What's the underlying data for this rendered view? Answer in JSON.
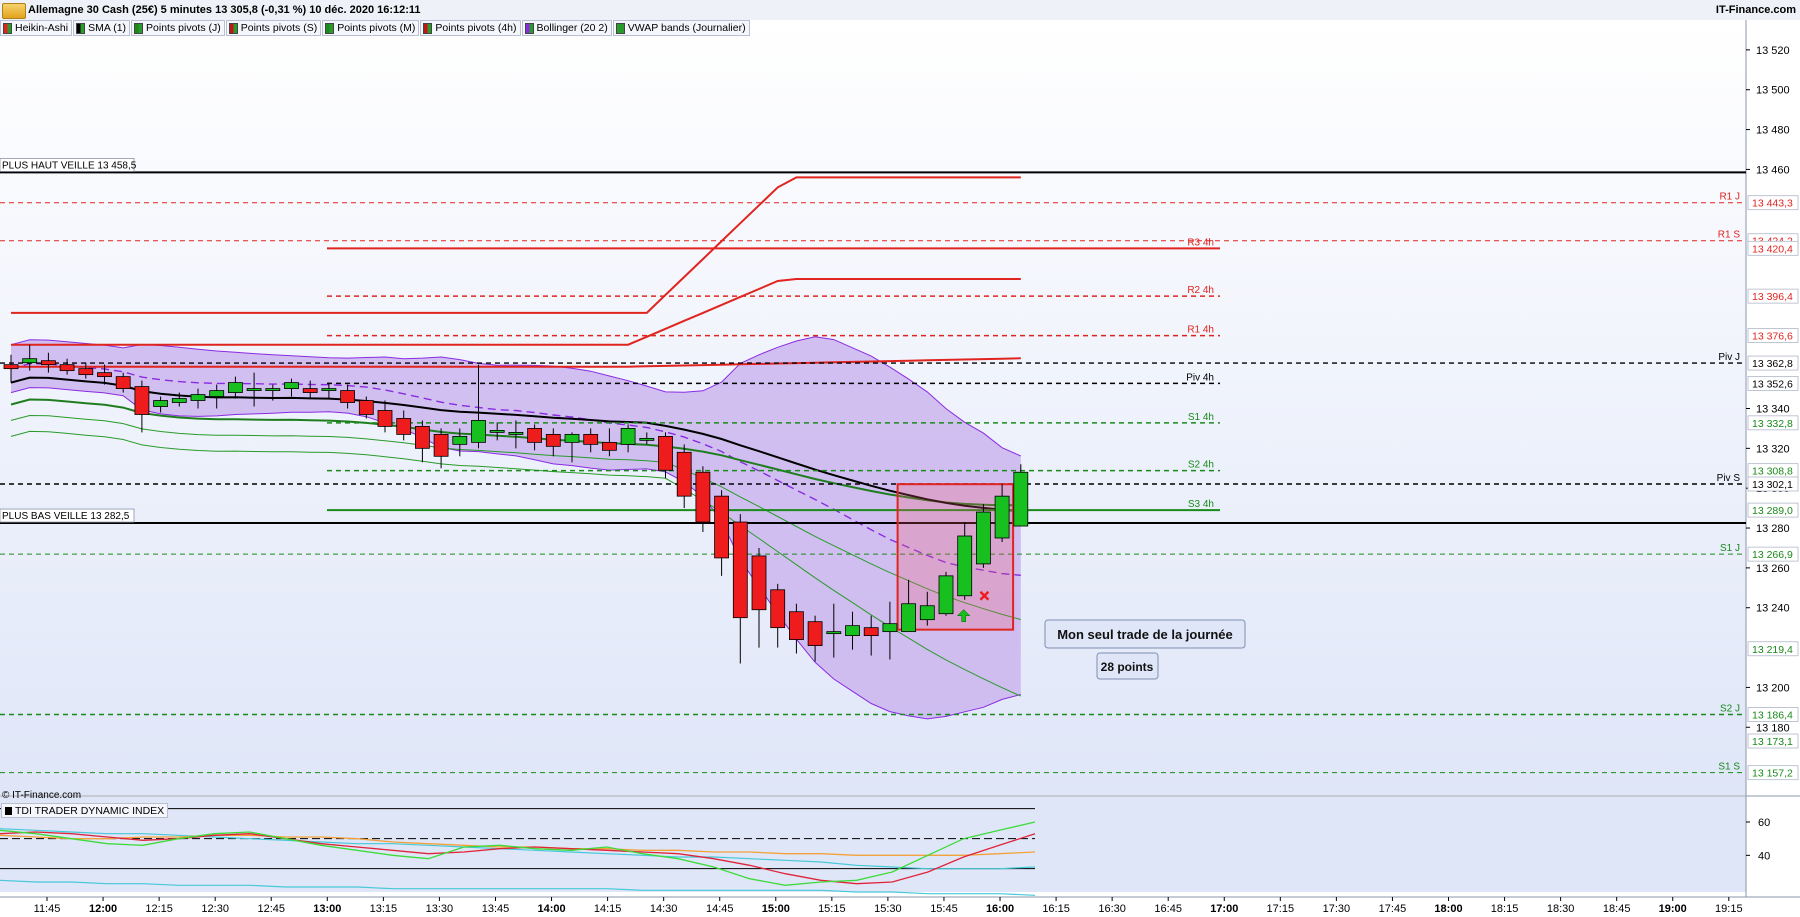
{
  "window": {
    "title": "Allemagne 30 Cash (25€) 5 minutes 13 305,8 (-0,31 %) 10 déc. 2020 16:12:11",
    "brand": "IT-Finance.com",
    "copyright": "© IT-Finance.com"
  },
  "legend": [
    {
      "label": "Heikin-Ashi",
      "color": "#e0241f"
    },
    {
      "label": "SMA (1)",
      "color": "#000000"
    },
    {
      "label": "Points pivots (J)",
      "color": "#1a8a1a"
    },
    {
      "label": "Points pivots (S)",
      "color": "#c21515"
    },
    {
      "label": "Points pivots (M)",
      "color": "#1a8a1a"
    },
    {
      "label": "Points pivots (4h)",
      "color": "#c21515"
    },
    {
      "label": "Bollinger (20 2)",
      "color": "#8a2be2"
    },
    {
      "label": "VWAP bands (Journalier)",
      "color": "#2a9a2a"
    }
  ],
  "tdi_title": "TDI TRADER DYNAMIC INDEX",
  "chart_data": {
    "type": "candlestick",
    "ylim": [
      13146,
      13535
    ],
    "y_ticks": [
      "13 520",
      "13 500",
      "13 480",
      "13 460",
      "13 340",
      "13 320",
      "13 300",
      "13 280",
      "13 260",
      "13 240",
      "13 200",
      "13 180"
    ],
    "y_tick_values": [
      13520,
      13500,
      13480,
      13460,
      13340,
      13320,
      13300,
      13280,
      13260,
      13240,
      13200,
      13180
    ],
    "x_ticks": [
      {
        "label": "11:45",
        "bold": false
      },
      {
        "label": "12:00",
        "bold": true
      },
      {
        "label": "12:15",
        "bold": false
      },
      {
        "label": "12:30",
        "bold": false
      },
      {
        "label": "12:45",
        "bold": false
      },
      {
        "label": "13:00",
        "bold": true
      },
      {
        "label": "13:15",
        "bold": false
      },
      {
        "label": "13:30",
        "bold": false
      },
      {
        "label": "13:45",
        "bold": false
      },
      {
        "label": "14:00",
        "bold": true
      },
      {
        "label": "14:15",
        "bold": false
      },
      {
        "label": "14:30",
        "bold": false
      },
      {
        "label": "14:45",
        "bold": false
      },
      {
        "label": "15:00",
        "bold": true
      },
      {
        "label": "15:15",
        "bold": false
      },
      {
        "label": "15:30",
        "bold": false
      },
      {
        "label": "15:45",
        "bold": false
      },
      {
        "label": "16:00",
        "bold": true
      },
      {
        "label": "16:15",
        "bold": false
      },
      {
        "label": "16:30",
        "bold": false
      },
      {
        "label": "16:45",
        "bold": false
      },
      {
        "label": "17:00",
        "bold": true
      },
      {
        "label": "17:15",
        "bold": false
      },
      {
        "label": "17:30",
        "bold": false
      },
      {
        "label": "17:45",
        "bold": false
      },
      {
        "label": "18:00",
        "bold": true
      },
      {
        "label": "18:15",
        "bold": false
      },
      {
        "label": "18:30",
        "bold": false
      },
      {
        "label": "18:45",
        "bold": false
      },
      {
        "label": "19:00",
        "bold": true
      },
      {
        "label": "19:15",
        "bold": false
      }
    ],
    "candles": [
      {
        "o": 13362,
        "h": 13367,
        "l": 13353,
        "c": 13360
      },
      {
        "o": 13363,
        "h": 13372,
        "l": 13359,
        "c": 13365
      },
      {
        "o": 13364,
        "h": 13368,
        "l": 13358,
        "c": 13362
      },
      {
        "o": 13362,
        "h": 13365,
        "l": 13357,
        "c": 13359
      },
      {
        "o": 13360,
        "h": 13363,
        "l": 13355,
        "c": 13357
      },
      {
        "o": 13358,
        "h": 13362,
        "l": 13352,
        "c": 13356
      },
      {
        "o": 13356,
        "h": 13358,
        "l": 13348,
        "c": 13350
      },
      {
        "o": 13351,
        "h": 13354,
        "l": 13328,
        "c": 13337
      },
      {
        "o": 13341,
        "h": 13346,
        "l": 13338,
        "c": 13344
      },
      {
        "o": 13343,
        "h": 13348,
        "l": 13341,
        "c": 13345
      },
      {
        "o": 13344,
        "h": 13350,
        "l": 13340,
        "c": 13347
      },
      {
        "o": 13346,
        "h": 13352,
        "l": 13340,
        "c": 13349
      },
      {
        "o": 13348,
        "h": 13356,
        "l": 13345,
        "c": 13353
      },
      {
        "o": 13350,
        "h": 13358,
        "l": 13341,
        "c": 13350
      },
      {
        "o": 13349,
        "h": 13352,
        "l": 13344,
        "c": 13350
      },
      {
        "o": 13350,
        "h": 13355,
        "l": 13346,
        "c": 13353
      },
      {
        "o": 13350,
        "h": 13354,
        "l": 13345,
        "c": 13348
      },
      {
        "o": 13349,
        "h": 13353,
        "l": 13345,
        "c": 13350
      },
      {
        "o": 13349,
        "h": 13352,
        "l": 13340,
        "c": 13343
      },
      {
        "o": 13344,
        "h": 13346,
        "l": 13335,
        "c": 13337
      },
      {
        "o": 13339,
        "h": 13344,
        "l": 13328,
        "c": 13331
      },
      {
        "o": 13335,
        "h": 13339,
        "l": 13324,
        "c": 13327
      },
      {
        "o": 13331,
        "h": 13334,
        "l": 13313,
        "c": 13320
      },
      {
        "o": 13327,
        "h": 13330,
        "l": 13310,
        "c": 13316
      },
      {
        "o": 13322,
        "h": 13330,
        "l": 13316,
        "c": 13326
      },
      {
        "o": 13323,
        "h": 13362,
        "l": 13320,
        "c": 13334
      },
      {
        "o": 13328,
        "h": 13333,
        "l": 13324,
        "c": 13329
      },
      {
        "o": 13328,
        "h": 13334,
        "l": 13320,
        "c": 13328
      },
      {
        "o": 13330,
        "h": 13332,
        "l": 13319,
        "c": 13323
      },
      {
        "o": 13327,
        "h": 13330,
        "l": 13316,
        "c": 13321
      },
      {
        "o": 13323,
        "h": 13328,
        "l": 13313,
        "c": 13327
      },
      {
        "o": 13327,
        "h": 13330,
        "l": 13318,
        "c": 13322
      },
      {
        "o": 13323,
        "h": 13330,
        "l": 13316,
        "c": 13319
      },
      {
        "o": 13322,
        "h": 13332,
        "l": 13318,
        "c": 13330
      },
      {
        "o": 13325,
        "h": 13328,
        "l": 13322,
        "c": 13325
      },
      {
        "o": 13326,
        "h": 13328,
        "l": 13305,
        "c": 13309
      },
      {
        "o": 13318,
        "h": 13322,
        "l": 13290,
        "c": 13296
      },
      {
        "o": 13308,
        "h": 13311,
        "l": 13278,
        "c": 13283
      },
      {
        "o": 13296,
        "h": 13299,
        "l": 13256,
        "c": 13265
      },
      {
        "o": 13283,
        "h": 13287,
        "l": 13212,
        "c": 13235
      },
      {
        "o": 13266,
        "h": 13270,
        "l": 13220,
        "c": 13239
      },
      {
        "o": 13249,
        "h": 13252,
        "l": 13220,
        "c": 13230
      },
      {
        "o": 13238,
        "h": 13242,
        "l": 13217,
        "c": 13224
      },
      {
        "o": 13233,
        "h": 13236,
        "l": 13213,
        "c": 13221
      },
      {
        "o": 13227,
        "h": 13242,
        "l": 13215,
        "c": 13228
      },
      {
        "o": 13226,
        "h": 13238,
        "l": 13219,
        "c": 13231
      },
      {
        "o": 13230,
        "h": 13236,
        "l": 13216,
        "c": 13226
      },
      {
        "o": 13228,
        "h": 13243,
        "l": 13214,
        "c": 13232
      },
      {
        "o": 13228,
        "h": 13254,
        "l": 13228,
        "c": 13242
      },
      {
        "o": 13234,
        "h": 13248,
        "l": 13231,
        "c": 13241
      },
      {
        "o": 13237,
        "h": 13258,
        "l": 13236,
        "c": 13256
      },
      {
        "o": 13246,
        "h": 13283,
        "l": 13244,
        "c": 13276
      },
      {
        "o": 13262,
        "h": 13292,
        "l": 13260,
        "c": 13288
      },
      {
        "o": 13275,
        "h": 13302,
        "l": 13273,
        "c": 13296
      },
      {
        "o": 13281,
        "h": 13312,
        "l": 13281,
        "c": 13308
      }
    ],
    "hlines": [
      {
        "value": 13458.5,
        "color": "#000000",
        "dash": false,
        "width": 2,
        "left_label": "PLUS HAUT VEILLE 13 458,5",
        "right_label": ""
      },
      {
        "value": 13443.3,
        "color": "#e0241f",
        "dash": true,
        "width": 1,
        "left_label": "",
        "right_label": "R1 J"
      },
      {
        "value": 13424.2,
        "color": "#e0241f",
        "dash": true,
        "width": 1,
        "left_label": "",
        "right_label": "R1 S"
      },
      {
        "value": 13362.8,
        "color": "#000000",
        "dash": true,
        "width": 1.4,
        "left_label": "",
        "right_label": "Piv J"
      },
      {
        "value": 13302.1,
        "color": "#000000",
        "dash": true,
        "width": 1.4,
        "left_label": "",
        "right_label": "Piv S"
      },
      {
        "value": 13282.5,
        "color": "#000000",
        "dash": false,
        "width": 2,
        "left_label": "PLUS BAS VEILLE 13 282,5",
        "right_label": ""
      },
      {
        "value": 13266.9,
        "color": "#1a8a1a",
        "dash": true,
        "width": 1,
        "left_label": "",
        "right_label": "S1 J"
      },
      {
        "value": 13186.4,
        "color": "#1a8a1a",
        "dash": true,
        "width": 1.4,
        "left_label": "",
        "right_label": "S2 J"
      },
      {
        "value": 13157.2,
        "color": "#1a8a1a",
        "dash": true,
        "width": 1,
        "left_label": "",
        "right_label": "S1 S"
      }
    ],
    "pivot4h": [
      {
        "value": 13420.4,
        "label": "R3 4h",
        "color": "#e0241f",
        "dash": false
      },
      {
        "value": 13396.4,
        "label": "R2 4h",
        "color": "#e0241f",
        "dash": true
      },
      {
        "value": 13376.6,
        "label": "R1 4h",
        "color": "#e0241f",
        "dash": true
      },
      {
        "value": 13352.6,
        "label": "Piv 4h",
        "color": "#000000",
        "dash": true
      },
      {
        "value": 13332.8,
        "label": "S1 4h",
        "color": "#1a8a1a",
        "dash": true
      },
      {
        "value": 13308.8,
        "label": "S2 4h",
        "color": "#1a8a1a",
        "dash": true
      },
      {
        "value": 13289.0,
        "label": "S3 4h",
        "color": "#1a8a1a",
        "dash": false
      }
    ],
    "price_tags": [
      {
        "value": 13443.3,
        "label": "13 443,3",
        "color": "#e0241f"
      },
      {
        "value": 13424.2,
        "label": "13 424,2",
        "color": "#e0241f"
      },
      {
        "value": 13420.4,
        "label": "13 420,4",
        "color": "#e0241f"
      },
      {
        "value": 13396.4,
        "label": "13 396,4",
        "color": "#e0241f"
      },
      {
        "value": 13376.6,
        "label": "13 376,6",
        "color": "#e0241f"
      },
      {
        "value": 13362.8,
        "label": "13 362,8",
        "color": "#000000"
      },
      {
        "value": 13352.6,
        "label": "13 352,6",
        "color": "#000000"
      },
      {
        "value": 13332.8,
        "label": "13 332,8",
        "color": "#1a8a1a"
      },
      {
        "value": 13308.8,
        "label": "13 308,8",
        "color": "#1a8a1a"
      },
      {
        "value": 13302.1,
        "label": "13 302,1",
        "color": "#000000"
      },
      {
        "value": 13289.0,
        "label": "13 289,0",
        "color": "#1a8a1a"
      },
      {
        "value": 13266.9,
        "label": "13 266,9",
        "color": "#1a8a1a"
      },
      {
        "value": 13219.4,
        "label": "13 219,4",
        "color": "#1a8a1a"
      },
      {
        "value": 13186.4,
        "label": "13 186,4",
        "color": "#1a8a1a"
      },
      {
        "value": 13173.1,
        "label": "13 173,1",
        "color": "#1a8a1a"
      },
      {
        "value": 13157.2,
        "label": "13 157,2",
        "color": "#1a8a1a"
      }
    ],
    "trade_box": {
      "from_index": 48,
      "to_index": 53,
      "low": 13229,
      "high": 13302
    },
    "annotations": [
      "Mon seul trade de la journée",
      "28 points"
    ],
    "tdi": {
      "y_ticks": [
        "60",
        "40"
      ],
      "y_tick_values": [
        60,
        40
      ],
      "ylim": [
        15,
        75
      ],
      "levels": [
        68,
        50,
        32
      ]
    },
    "colors": {
      "bull": "#18c01f",
      "bear": "#ee1c1c",
      "bollinger_fill": "#c9b1ee",
      "bollinger_line": "#8a2be2",
      "vwap": "#2a9a2a"
    }
  }
}
